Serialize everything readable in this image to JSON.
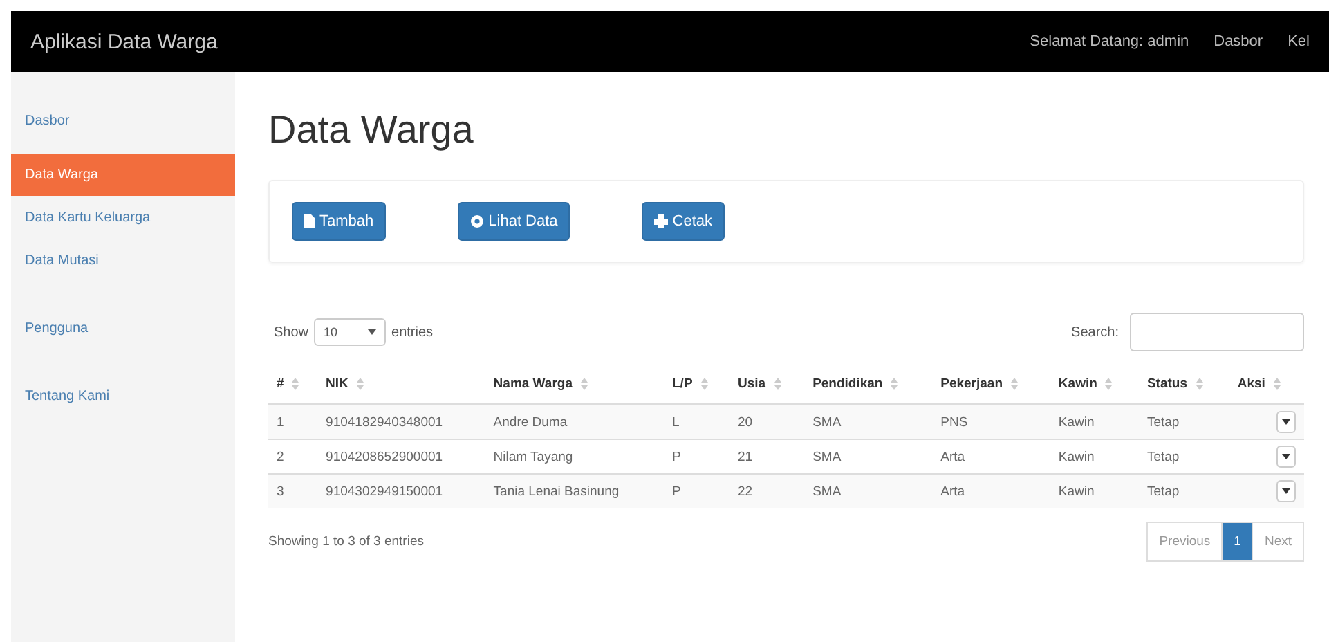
{
  "navbar": {
    "brand": "Aplikasi Data Warga",
    "links": [
      "Selamat Datang: admin",
      "Dasbor",
      "Kel"
    ]
  },
  "sidebar": {
    "items": [
      {
        "label": "Dasbor",
        "selected": false
      },
      {
        "label": "Data Warga",
        "selected": true
      },
      {
        "label": "Data Kartu Keluarga",
        "selected": false
      },
      {
        "label": "Data Mutasi",
        "selected": false
      },
      {
        "label": "Pengguna",
        "selected": false
      },
      {
        "label": "Tentang Kami",
        "selected": false
      }
    ]
  },
  "page_title": "Data Warga",
  "actions": [
    {
      "label": "Tambah",
      "kind": "file"
    },
    {
      "label": "Lihat Data",
      "kind": "eye"
    },
    {
      "label": "Cetak",
      "kind": "print"
    }
  ],
  "table_controls": {
    "show_label": "Show",
    "page_size": "10",
    "entries_label": "entries",
    "search_label": "Search:"
  },
  "table": {
    "columns": [
      "#",
      "NIK",
      "Nama Warga",
      "L/P",
      "Usia",
      "Pendidikan",
      "Pekerjaan",
      "Kawin",
      "Status",
      "Aksi"
    ],
    "rows": [
      [
        "1",
        "9104182940348001",
        "Andre Duma",
        "L",
        "20",
        "SMA",
        "PNS",
        "Kawin",
        "Tetap"
      ],
      [
        "2",
        "9104208652900001",
        "Nilam Tayang",
        "P",
        "21",
        "SMA",
        "Arta",
        "Kawin",
        "Tetap"
      ],
      [
        "3",
        "9104302949150001",
        "Tania Lenai Basinung",
        "P",
        "22",
        "SMA",
        "Arta",
        "Kawin",
        "Tetap"
      ]
    ]
  },
  "footer": {
    "info": "Showing 1 to 3 of 3 entries",
    "pages": [
      {
        "label": "Previous",
        "selected": false
      },
      {
        "label": "1",
        "selected": true
      },
      {
        "label": "Next",
        "selected": false
      }
    ]
  }
}
